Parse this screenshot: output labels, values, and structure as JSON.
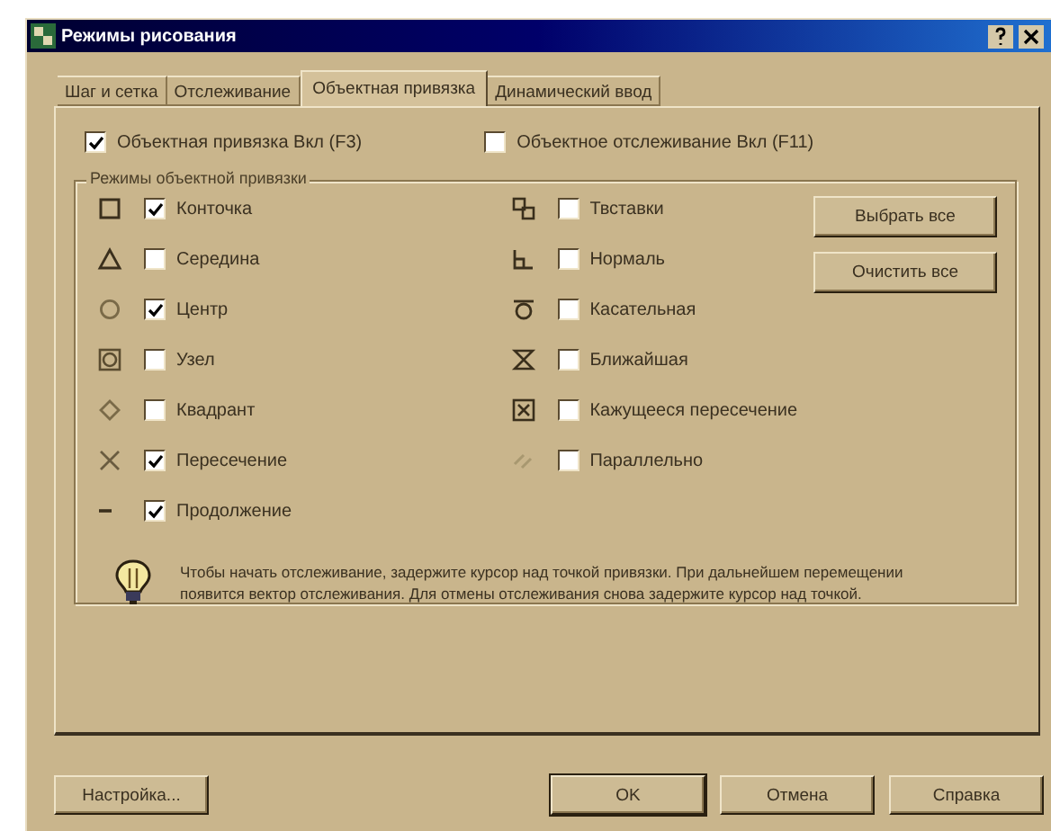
{
  "window": {
    "title": "Режимы рисования"
  },
  "tabs": [
    {
      "label": "Шаг и сетка",
      "selected": false
    },
    {
      "label": "Отслеживание",
      "selected": false
    },
    {
      "label": "Объектная привязка",
      "selected": true
    },
    {
      "label": "Динамический ввод",
      "selected": false
    }
  ],
  "toggles": [
    {
      "label": "Объектная привязка Вкл (F3)",
      "checked": true
    },
    {
      "label": "Объектное отслеживание Вкл (F11)",
      "checked": false
    }
  ],
  "group": {
    "title": "Режимы объектной привязки",
    "left_modes": [
      {
        "kind": "endpoint",
        "label": "Конточка",
        "checked": true
      },
      {
        "kind": "midpoint",
        "label": "Середина",
        "checked": false
      },
      {
        "kind": "center",
        "label": "Центр",
        "checked": true
      },
      {
        "kind": "node",
        "label": "Узел",
        "checked": false
      },
      {
        "kind": "quadrant",
        "label": "Квадрант",
        "checked": false
      },
      {
        "kind": "intersection",
        "label": "Пересечение",
        "checked": true
      },
      {
        "kind": "extension",
        "label": "Продолжение",
        "checked": true
      }
    ],
    "right_modes": [
      {
        "kind": "insertion",
        "label": "Твставки",
        "checked": false
      },
      {
        "kind": "perpendicular",
        "label": "Нормаль",
        "checked": false
      },
      {
        "kind": "tangent",
        "label": "Касательная",
        "checked": false
      },
      {
        "kind": "nearest",
        "label": "Ближайшая",
        "checked": false
      },
      {
        "kind": "apparent",
        "label": "Кажущееся пересечение",
        "checked": false
      },
      {
        "kind": "parallel",
        "label": "Параллельно",
        "checked": false
      }
    ],
    "buttons": [
      "Выбрать все",
      "Очистить все"
    ],
    "note": "Чтобы начать отслеживание, задержите курсор над точкой привязки. При дальнейшем перемещении появится вектор отслеживания. Для отмены отслеживания снова задержите курсор над точкой."
  },
  "options_button": "Настройка...",
  "buttons": [
    "OK",
    "Отмена",
    "Справка"
  ]
}
